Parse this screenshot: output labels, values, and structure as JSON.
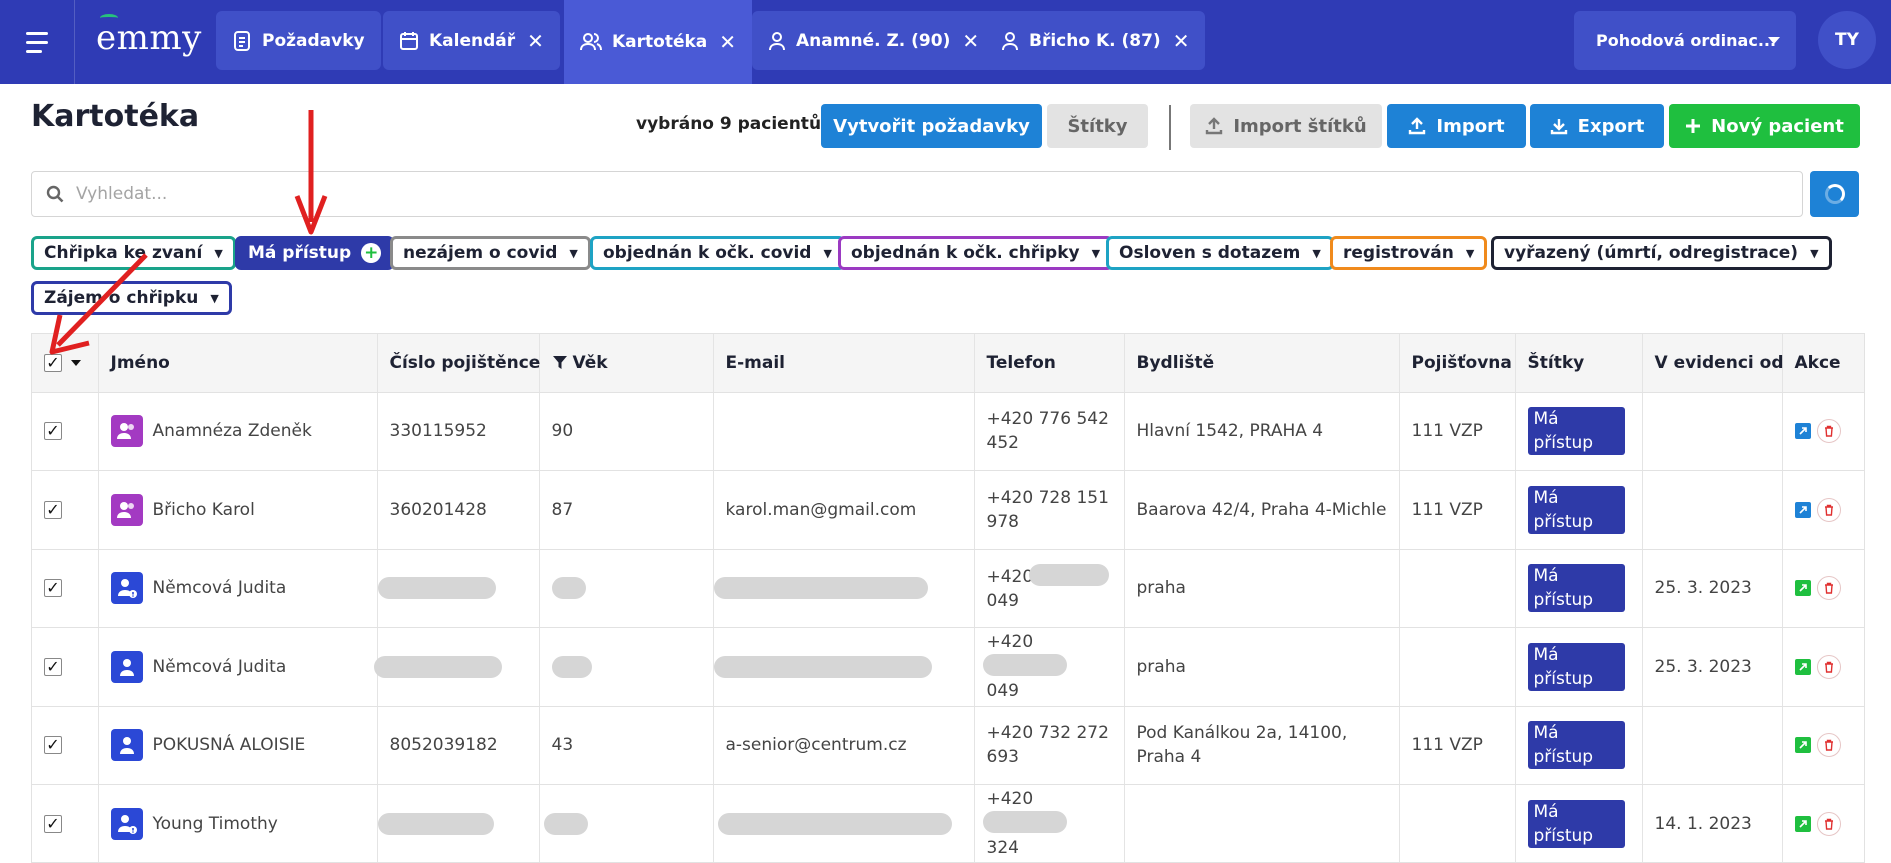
{
  "app": {
    "logo": "emmy"
  },
  "topnav": {
    "tabs": [
      {
        "label": "Požadavky",
        "icon": "clipboard-icon",
        "closable": false
      },
      {
        "label": "Kalendář",
        "icon": "calendar-icon",
        "closable": true
      },
      {
        "label": "Kartotéka",
        "icon": "users-icon",
        "closable": true,
        "active": true
      },
      {
        "label": "Anamné. Z. (90)",
        "icon": "user-icon",
        "closable": true
      },
      {
        "label": "Břicho K. (87)",
        "icon": "user-icon",
        "closable": true
      }
    ],
    "clinic": "Pohodová ordinac...",
    "avatar": "TY",
    "close_glyph": "✕"
  },
  "page": {
    "title": "Kartotéka",
    "selected_info": "vybráno 9 pacientů",
    "buttons": {
      "create_requests": "Vytvořit požadavky",
      "tags": "Štítky",
      "import_tags": "Import štítků",
      "import": "Import",
      "export": "Export",
      "new_patient": "Nový pacient"
    }
  },
  "search": {
    "placeholder": "Vyhledat..."
  },
  "filters": [
    {
      "label": "Chřipka ke zvaní",
      "color": "#1aa38a"
    },
    {
      "label": "Má přístup",
      "color": "#2e3aa8",
      "filled": true
    },
    {
      "label": "nezájem o covid",
      "color": "#8a8a8a"
    },
    {
      "label": "objednán k očk. covid",
      "color": "#1ea3c4"
    },
    {
      "label": "objednán k očk. chřipky",
      "color": "#9b3ac2"
    },
    {
      "label": "Osloven s dotazem",
      "color": "#1ea3c4"
    },
    {
      "label": "registrován",
      "color": "#f08a1c"
    },
    {
      "label": "vyřazený (úmrtí, odregistrace)",
      "color": "#1e2233"
    },
    {
      "label": "Zájem o chřipku",
      "color": "#2e3aa8"
    }
  ],
  "table": {
    "columns": [
      "Jméno",
      "Číslo pojištěnce",
      "Věk",
      "E-mail",
      "Telefon",
      "Bydliště",
      "Pojišťovna",
      "Štítky",
      "V evidenci od",
      "Akce"
    ],
    "rows": [
      {
        "name": "Anamnéza Zdeněk",
        "avatar": "purple",
        "insurance_no": "330115952",
        "age": "90",
        "email": "",
        "phone": "+420 776 542 452",
        "address": "Hlavní 1542, PRAHA 4",
        "insurer": "111 VZP",
        "tag": "Má přístup",
        "since": "",
        "edit": "blue"
      },
      {
        "name": "Břicho Karol",
        "avatar": "purple",
        "insurance_no": "360201428",
        "age": "87",
        "email": "karol.man@gmail.com",
        "phone": "+420 728 151 978",
        "address": "Baarova 42/4, Praha 4-Michle",
        "insurer": "111 VZP",
        "tag": "Má přístup",
        "since": "",
        "edit": "blue"
      },
      {
        "name": "Němcová Judita",
        "avatar": "blue-warn",
        "insurance_no": "",
        "age": "",
        "email": "",
        "phone_start": "+420",
        "phone_end": "049",
        "address": "praha",
        "insurer": "",
        "tag": "Má přístup",
        "since": "25. 3. 2023",
        "edit": "green",
        "blurred": true
      },
      {
        "name": "Němcová Judita",
        "avatar": "blue",
        "insurance_no": "",
        "age": "",
        "email": "",
        "phone_start": "+420",
        "phone_end": "049",
        "address": "praha",
        "insurer": "",
        "tag": "Má přístup",
        "since": "25. 3. 2023",
        "edit": "green",
        "blurred": true
      },
      {
        "name": "POKUSNÁ ALOISIE",
        "avatar": "blue",
        "insurance_no": "8052039182",
        "age": "43",
        "email": "a-senior@centrum.cz",
        "phone": "+420 732 272 693",
        "address": "Pod Kanálkou 2a, 14100, Praha 4",
        "insurer": "111 VZP",
        "tag": "Má přístup",
        "since": "",
        "edit": "green"
      },
      {
        "name": "Young Timothy",
        "avatar": "blue-warn",
        "insurance_no": "",
        "age": "",
        "email": "",
        "phone_start": "+420",
        "phone_end": "324",
        "address": "",
        "insurer": "",
        "tag": "Má přístup",
        "since": "14. 1. 2023",
        "edit": "green",
        "blurred": true
      }
    ]
  },
  "colors": {
    "topbar": "#2f3bb5",
    "primary": "#1e82d6",
    "success": "#1fbf3f",
    "tag": "#2e3aa8",
    "annotation": "#e02020"
  }
}
